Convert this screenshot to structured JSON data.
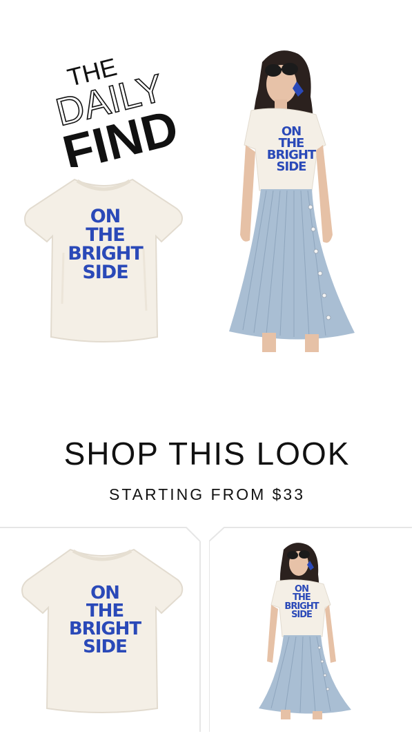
{
  "logo": {
    "line1": "THE",
    "line2": "DAILY",
    "line3": "FIND"
  },
  "hero_tee_print": [
    "ON",
    "THE",
    "BRIGHT",
    "SIDE"
  ],
  "model_tee_print": [
    "ON",
    "THE",
    "BRIGHT",
    "SIDE"
  ],
  "shop": {
    "title": "SHOP THIS LOOK",
    "subtitle": "STARTING FROM $33"
  },
  "products": [
    {
      "print": [
        "ON",
        "THE",
        "BRIGHT",
        "SIDE"
      ]
    },
    {
      "print": [
        "ON",
        "THE",
        "BRIGHT",
        "SIDE"
      ]
    }
  ],
  "colors": {
    "print_blue": "#2a49b8",
    "tee": "#f4efe6",
    "skirt": "#a9bed3",
    "frame": "#e6e6e6"
  }
}
